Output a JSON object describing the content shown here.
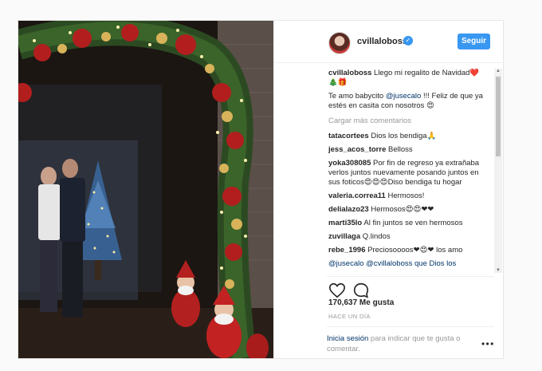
{
  "post": {
    "username": "cvillaloboss",
    "verified_badge": "verified-icon",
    "follow_label": "Seguir",
    "caption": {
      "user": "cvillaloboss",
      "text": "Llego mi regalito de Navidad❤️🎄🎁",
      "line2_pre": "Te amo babycito ",
      "line2_mention": "@jusecalo",
      "line2_post": " !!! Feliz de que ya estés en casita con nosotros 😍"
    },
    "load_more": "Cargar más comentarios",
    "comments": [
      {
        "user": "tatacortees",
        "text": "Dios los bendiga🙏"
      },
      {
        "user": "jess_acos_torre",
        "text": "Belloss"
      },
      {
        "user": "yoka308085",
        "text": "Por fin de regreso ya extrañaba verlos juntos nuevamente posando juntos en sus foticos😍😍😍Diso bendiga tu hogar"
      },
      {
        "user": "valeria.correa11",
        "text": "Hermosos!"
      },
      {
        "user": "delialazo23",
        "text": "Hermosos😍😍❤❤"
      },
      {
        "user": "marti35lo",
        "text": "Al fin juntos se ven hermosos"
      },
      {
        "user": "zuvillaga",
        "text": "Q.lindos"
      },
      {
        "user": "rebe_1996",
        "text": "Preciosoooos❤😍❤ los amo"
      },
      {
        "user": "",
        "text": "@jusecalo @cvillaloboss que Dios los"
      }
    ],
    "likes": "170,637 Me gusta",
    "time": "Hace un día",
    "login_link": "Inicia sesión",
    "login_text": " para indicar que te gusta o comentar."
  },
  "icons": {
    "like": "heart-icon",
    "comment": "comment-icon",
    "more": "more-options-icon"
  },
  "colors": {
    "accent": "#3897f0",
    "link": "#003569"
  }
}
